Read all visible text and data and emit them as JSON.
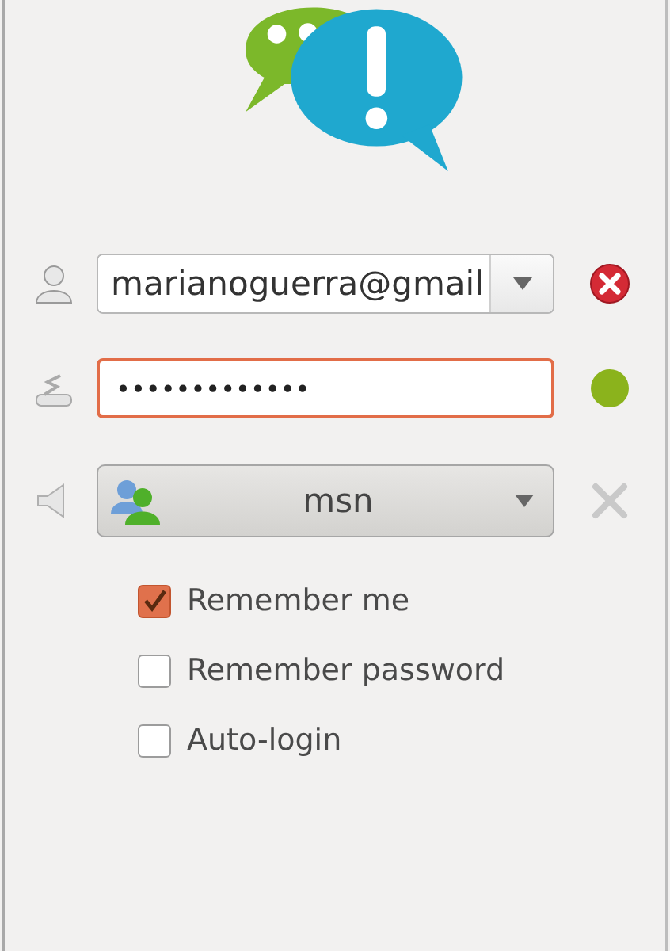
{
  "account": {
    "value": "marianoguerra@gmail"
  },
  "password": {
    "value": "•••••••••••••",
    "focused": true
  },
  "status": {
    "color": "#8bb31c"
  },
  "protocol": {
    "label": "msn"
  },
  "options": [
    {
      "label": "Remember me",
      "checked": true
    },
    {
      "label": "Remember password",
      "checked": false
    },
    {
      "label": "Auto-login",
      "checked": false
    }
  ]
}
